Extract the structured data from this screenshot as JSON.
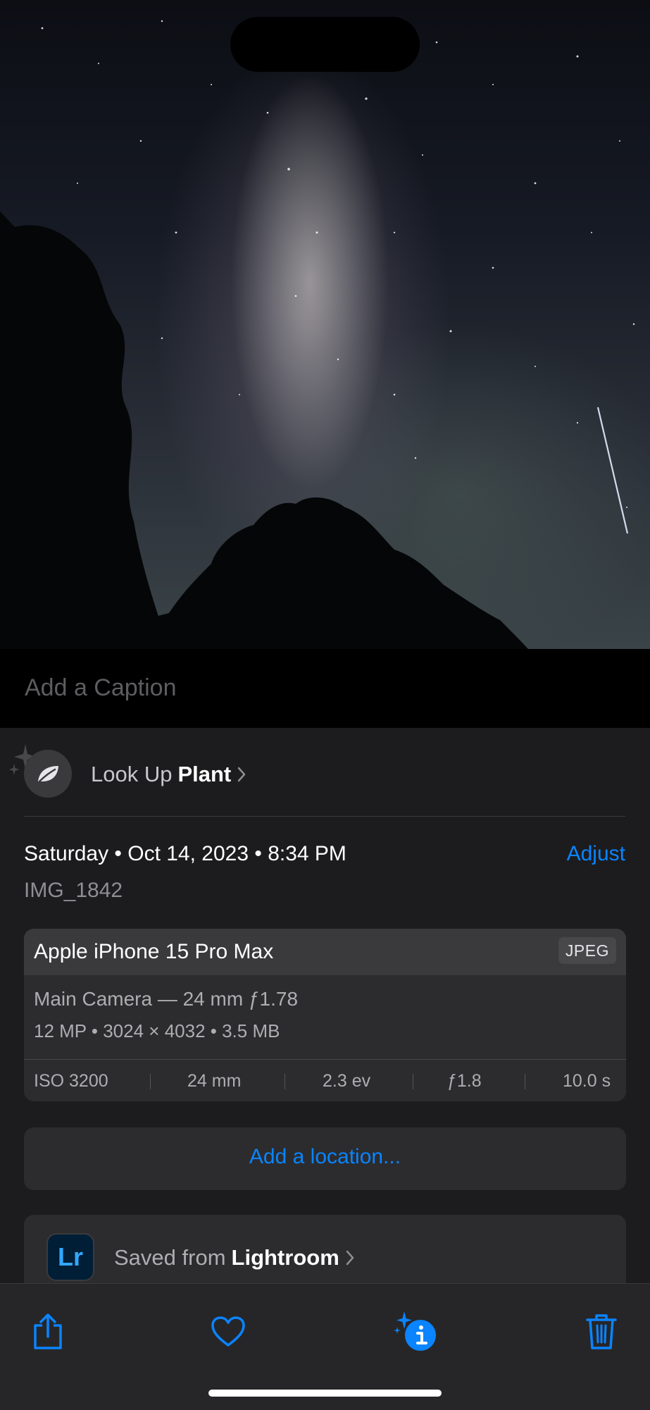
{
  "photo": {
    "description_icon": "milky-way-photo"
  },
  "caption": {
    "placeholder": "Add a Caption"
  },
  "lookup": {
    "prefix": "Look Up",
    "subject": "Plant"
  },
  "info": {
    "date": "Saturday • Oct 14, 2023 • 8:34 PM",
    "adjust_label": "Adjust",
    "filename": "IMG_1842"
  },
  "camera": {
    "device": "Apple iPhone 15 Pro Max",
    "format": "JPEG",
    "lens": "Main Camera — 24 mm ƒ1.78",
    "specs": "12 MP  •  3024 × 4032  •  3.5 MB",
    "exif": [
      "ISO 3200",
      "24 mm",
      "2.3 ev",
      "ƒ1.8",
      "10.0 s"
    ]
  },
  "location": {
    "label": "Add a location..."
  },
  "source": {
    "prefix": "Saved from",
    "app": "Lightroom",
    "app_icon_text": "Lr"
  },
  "toolbar": {
    "icons": [
      "share-icon",
      "heart-icon",
      "info-sparkle-icon",
      "trash-icon"
    ]
  },
  "colors": {
    "accent": "#0a84ff",
    "background": "#1c1c1e"
  }
}
